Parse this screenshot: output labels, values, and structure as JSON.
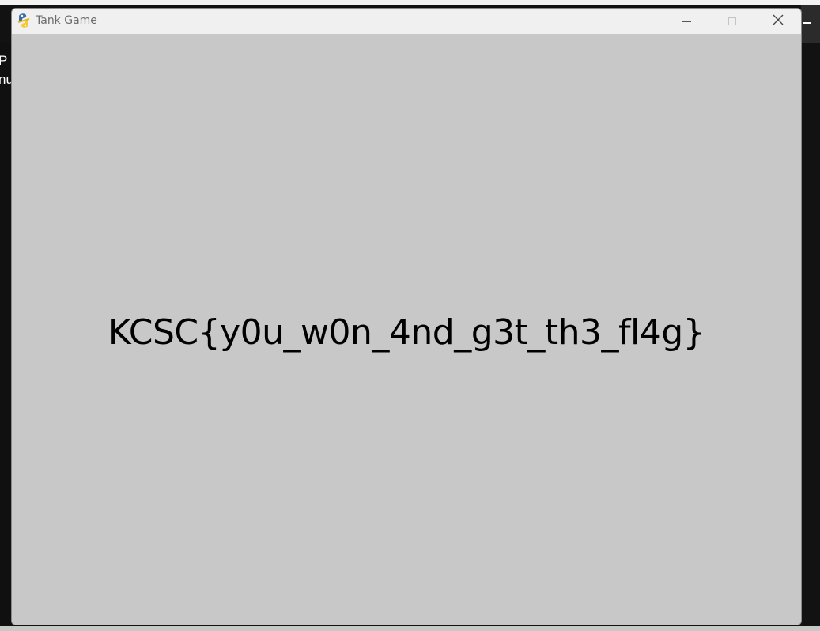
{
  "background": {
    "left_text_lines": [
      "P",
      "nu"
    ]
  },
  "window": {
    "title": "Tank Game",
    "icon": "pygame-snake-icon"
  },
  "content": {
    "message": "KCSC{y0u_w0n_4nd_g3t_th3_fl4g}"
  },
  "colors": {
    "client_bg": "#c8c8c8",
    "titlebar_bg": "#f0f0f0",
    "message_text": "#000000"
  }
}
